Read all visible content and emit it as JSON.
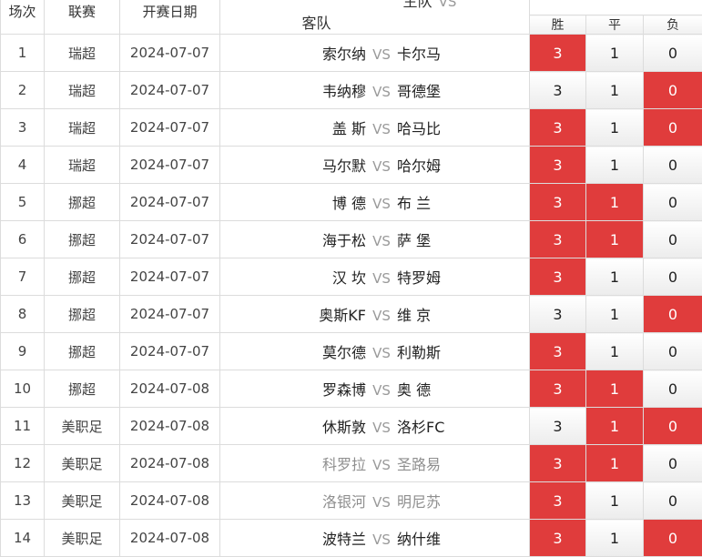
{
  "header": {
    "col_no": "场次",
    "col_league": "联赛",
    "col_date": "开赛日期",
    "col_home": "主队",
    "col_vs": "VS",
    "col_away": "客队",
    "col_win": "胜",
    "col_draw": "平",
    "col_loss": "负"
  },
  "matches": [
    {
      "no": "1",
      "league": "瑞超",
      "date": "2024-07-07",
      "home": "索尔纳",
      "vs": "VS",
      "away": "卡尔马",
      "win": "3",
      "draw": "1",
      "loss": "0",
      "hit": "win"
    },
    {
      "no": "2",
      "league": "瑞超",
      "date": "2024-07-07",
      "home": "韦纳穆",
      "vs": "VS",
      "away": "哥德堡",
      "win": "3",
      "draw": "1",
      "loss": "0",
      "hit": "loss"
    },
    {
      "no": "3",
      "league": "瑞超",
      "date": "2024-07-07",
      "home": "盖 斯",
      "vs": "VS",
      "away": "哈马比",
      "win": "3",
      "draw": "1",
      "loss": "0",
      "hit": "win,loss"
    },
    {
      "no": "4",
      "league": "瑞超",
      "date": "2024-07-07",
      "home": "马尔默",
      "vs": "VS",
      "away": "哈尔姆",
      "win": "3",
      "draw": "1",
      "loss": "0",
      "hit": "win"
    },
    {
      "no": "5",
      "league": "挪超",
      "date": "2024-07-07",
      "home": "博 德",
      "vs": "VS",
      "away": "布 兰",
      "win": "3",
      "draw": "1",
      "loss": "0",
      "hit": "win,draw"
    },
    {
      "no": "6",
      "league": "挪超",
      "date": "2024-07-07",
      "home": "海于松",
      "vs": "VS",
      "away": "萨 堡",
      "win": "3",
      "draw": "1",
      "loss": "0",
      "hit": "win,draw"
    },
    {
      "no": "7",
      "league": "挪超",
      "date": "2024-07-07",
      "home": "汉 坎",
      "vs": "VS",
      "away": "特罗姆",
      "win": "3",
      "draw": "1",
      "loss": "0",
      "hit": "win"
    },
    {
      "no": "8",
      "league": "挪超",
      "date": "2024-07-07",
      "home": "奥斯KF",
      "vs": "VS",
      "away": "维 京",
      "win": "3",
      "draw": "1",
      "loss": "0",
      "hit": "loss"
    },
    {
      "no": "9",
      "league": "挪超",
      "date": "2024-07-07",
      "home": "莫尔德",
      "vs": "VS",
      "away": "利勒斯",
      "win": "3",
      "draw": "1",
      "loss": "0",
      "hit": "win"
    },
    {
      "no": "10",
      "league": "挪超",
      "date": "2024-07-08",
      "home": "罗森博",
      "vs": "VS",
      "away": "奥 德",
      "win": "3",
      "draw": "1",
      "loss": "0",
      "hit": "win,draw"
    },
    {
      "no": "11",
      "league": "美职足",
      "date": "2024-07-08",
      "home": "休斯敦",
      "vs": "VS",
      "away": "洛杉FC",
      "win": "3",
      "draw": "1",
      "loss": "0",
      "hit": "draw,loss"
    },
    {
      "no": "12",
      "league": "美职足",
      "date": "2024-07-08",
      "home": "科罗拉",
      "vs": "VS",
      "away": "圣路易",
      "win": "3",
      "draw": "1",
      "loss": "0",
      "hit": "win,draw",
      "muted": true
    },
    {
      "no": "13",
      "league": "美职足",
      "date": "2024-07-08",
      "home": "洛银河",
      "vs": "VS",
      "away": "明尼苏",
      "win": "3",
      "draw": "1",
      "loss": "0",
      "hit": "win",
      "muted": true
    },
    {
      "no": "14",
      "league": "美职足",
      "date": "2024-07-08",
      "home": "波特兰",
      "vs": "VS",
      "away": "纳什维",
      "win": "3",
      "draw": "1",
      "loss": "0",
      "hit": "win,loss"
    }
  ],
  "colors": {
    "highlight": "#e03c3c",
    "border": "#dcdcdc",
    "muted_text": "#8f8f8f"
  }
}
